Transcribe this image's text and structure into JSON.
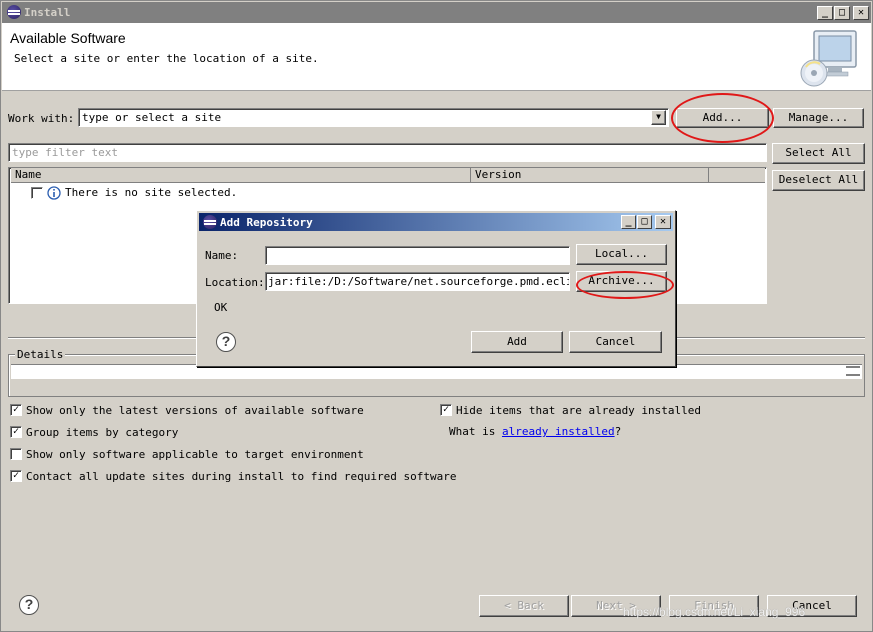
{
  "window": {
    "title": "Install",
    "minimize": "_",
    "maximize": "□",
    "close": "✕"
  },
  "header": {
    "title": "Available Software",
    "subtitle": "Select a site or enter the location of a site."
  },
  "work_with": {
    "label": "Work with:",
    "value": "type or select a site",
    "add_label": "Add...",
    "manage_label": "Manage..."
  },
  "filter": {
    "placeholder": "type filter text"
  },
  "side_buttons": {
    "select_all": "Select All",
    "deselect_all": "Deselect All"
  },
  "table": {
    "columns": [
      "Name",
      "Version"
    ],
    "message": "There is no site selected."
  },
  "details": {
    "label": "Details"
  },
  "options": {
    "latest_versions": {
      "label": "Show only the latest versions of available software",
      "checked": true
    },
    "group_by_category": {
      "label": "Group items by category",
      "checked": true
    },
    "target_env": {
      "label": "Show only software applicable to target environment",
      "checked": false
    },
    "contact_all": {
      "label": "Contact all update sites during install to find required software",
      "checked": true
    },
    "hide_installed": {
      "label": "Hide items that are already installed",
      "checked": true
    },
    "what_is_prefix": "What is ",
    "what_is_link": "already installed",
    "what_is_suffix": "?"
  },
  "footer": {
    "back": "< Back",
    "next": "Next >",
    "finish": "Finish",
    "cancel": "Cancel"
  },
  "dialog": {
    "title": "Add Repository",
    "name_label": "Name:",
    "name_value": "",
    "location_label": "Location:",
    "location_value": "jar:file:/D:/Software/net.sourceforge.pmd.eclipse.",
    "local_label": "Local...",
    "archive_label": "Archive...",
    "status": "OK",
    "add_label": "Add",
    "cancel_label": "Cancel"
  },
  "watermark": "https://blog.csdn.net/Li_xiang_996",
  "colors": {
    "annotation": "#e01818",
    "dialog_title_start": "#0a246a",
    "dialog_title_end": "#a6caf0",
    "link": "#0000ee"
  }
}
